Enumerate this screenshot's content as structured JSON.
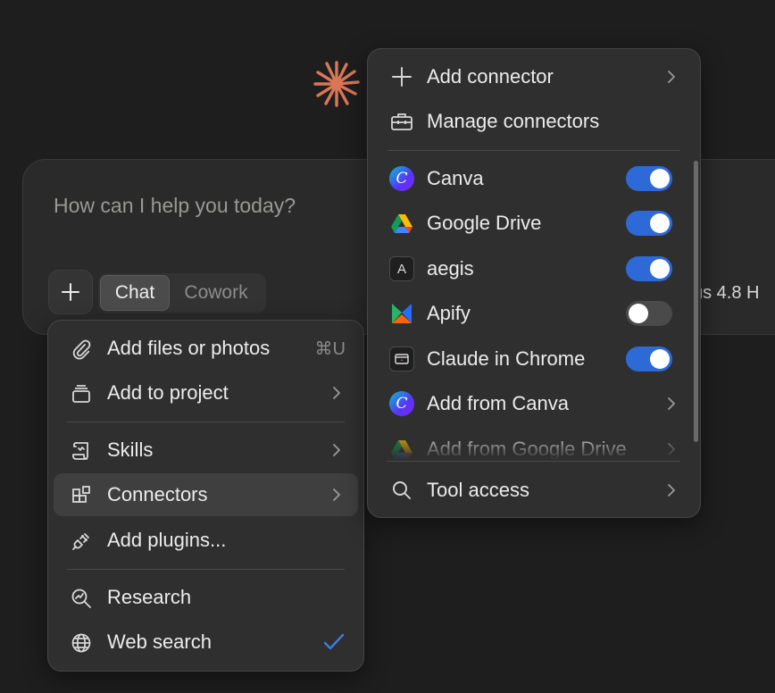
{
  "composer": {
    "placeholder": "How can I help you today?",
    "mode_tabs": [
      {
        "label": "Chat",
        "selected": true
      },
      {
        "label": "Cowork",
        "selected": false
      }
    ],
    "model_label": "us 4.8  H"
  },
  "attach_menu": {
    "items": [
      {
        "label": "Add files or photos",
        "shortcut": "⌘U",
        "icon": "paperclip-icon"
      },
      {
        "label": "Add to project",
        "icon": "project-box-icon",
        "has_submenu": true
      },
      {
        "label": "Skills",
        "icon": "scroll-icon",
        "has_submenu": true
      },
      {
        "label": "Connectors",
        "icon": "connectors-grid-icon",
        "has_submenu": true,
        "active": true
      },
      {
        "label": "Add plugins...",
        "icon": "plug-icon"
      },
      {
        "label": "Research",
        "icon": "research-icon"
      },
      {
        "label": "Web search",
        "icon": "globe-icon",
        "checked": true
      }
    ]
  },
  "connectors_menu": {
    "actions": [
      {
        "label": "Add connector",
        "icon": "plus-icon",
        "has_submenu": true
      },
      {
        "label": "Manage connectors",
        "icon": "toolbox-icon"
      }
    ],
    "connectors": [
      {
        "label": "Canva",
        "icon": "canva-icon",
        "enabled": true
      },
      {
        "label": "Google Drive",
        "icon": "google-drive-icon",
        "enabled": true
      },
      {
        "label": "aegis",
        "icon": "aegis-icon",
        "icon_text": "A",
        "enabled": true
      },
      {
        "label": "Apify",
        "icon": "apify-icon",
        "enabled": false
      },
      {
        "label": "Claude in Chrome",
        "icon": "chrome-extension-icon",
        "enabled": true
      },
      {
        "label": "Add from Canva",
        "icon": "canva-icon",
        "has_submenu": true
      },
      {
        "label": "Add from Google Drive",
        "icon": "google-drive-icon",
        "has_submenu": true
      }
    ],
    "footer": {
      "label": "Tool access",
      "icon": "search-icon",
      "has_submenu": true
    }
  },
  "colors": {
    "background": "#1e1e1e",
    "menu": "#2f2f2f",
    "toggle_on": "#2d6ad7",
    "toggle_off": "#4a4a4a",
    "check": "#3b7ddd",
    "logo": "#d97757"
  }
}
